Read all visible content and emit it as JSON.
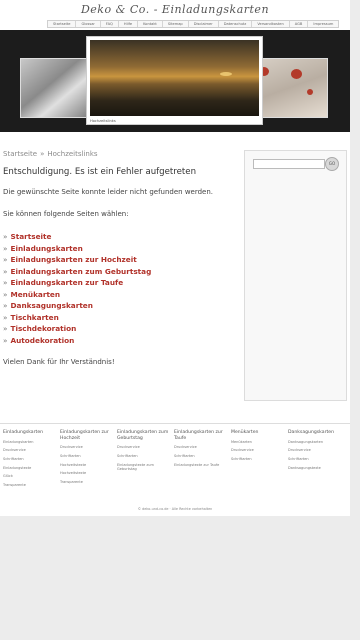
{
  "header": {
    "logo": "Deko & Co. - Einladungskarten",
    "nav": [
      "Startseite",
      "Glossar",
      "FAQ",
      "Hilfe",
      "Kontakt",
      "Sitemap",
      "Disclaimer",
      "Datenschutz",
      "Versandkosten",
      "AGB",
      "Impressum"
    ]
  },
  "hero": {
    "caption": "Hochzeitslinks"
  },
  "breadcrumb": {
    "home": "Startseite",
    "separator": "»",
    "current": "Hochzeitslinks"
  },
  "content": {
    "title": "Entschuldigung. Es ist ein Fehler aufgetreten",
    "not_found": "Die gewünschte Seite konnte leider nicht gefunden werden.",
    "choose": "Sie können folgende Seiten wählen:",
    "links": [
      "Startseite",
      "Einladungskarten",
      "Einladungskarten zur Hochzeit",
      "Einladungskarten zum Geburtstag",
      "Einladungskarten zur Taufe",
      "Menükarten",
      "Danksagungskarten",
      "Tischkarten",
      "Tischdekoration",
      "Autodekoration"
    ],
    "thanks": "Vielen Dank für Ihr Verständnis!"
  },
  "sidebar": {
    "search_button": "GO"
  },
  "footer": {
    "columns": [
      {
        "title": "Einladungskarten",
        "links": [
          "Einladungskarten",
          "Druckservice",
          "Schriftarten",
          "Einladungstexte",
          "Glück",
          "Transparente"
        ]
      },
      {
        "title": "Einladungskarten zur Hochzeit",
        "links": [
          "Druckservice",
          "Schriftarten",
          "Hochzeitstexte",
          "Hochzeitstexte",
          "Transparente"
        ]
      },
      {
        "title": "Einladungskarten zum Geburtstag",
        "links": [
          "Druckservice",
          "Schriftarten",
          "Einladungstexte zum Geburtstag"
        ]
      },
      {
        "title": "Einladungskarten zur Taufe",
        "links": [
          "Druckservice",
          "Schriftarten",
          "Einladungstexte zur Taufe"
        ]
      },
      {
        "title": "Menükarten",
        "links": [
          "Menükarten",
          "Druckservice",
          "Schriftarten"
        ]
      },
      {
        "title": "Danksagungskarten",
        "links": [
          "Danksagungskarten",
          "Druckservice",
          "Schriftarten",
          "Danksagungstexte"
        ]
      }
    ],
    "copyright": "© deko-und-co.de · Alle Rechte vorbehalten"
  }
}
